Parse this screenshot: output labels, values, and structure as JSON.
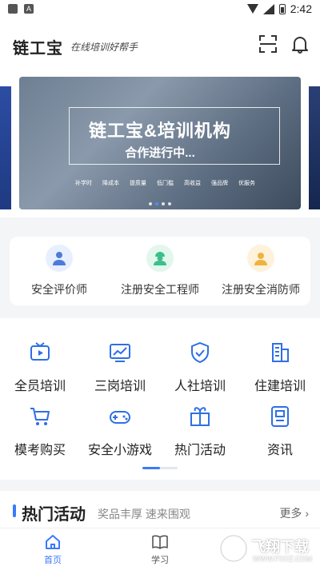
{
  "status_bar": {
    "time": "2:42",
    "left_icon": "A"
  },
  "header": {
    "logo": "链工宝",
    "slogan": "在线培训好帮手"
  },
  "banner": {
    "title": "链工宝&培训机构",
    "subtitle": "合作进行中...",
    "tags": [
      "补学时",
      "降成本",
      "提质量",
      "低门槛",
      "高收益",
      "强品牌",
      "优服务"
    ]
  },
  "certifications": [
    {
      "label": "安全评价师",
      "icon": "evaluator-icon",
      "color": "#4e7bd9"
    },
    {
      "label": "注册安全工程师",
      "icon": "engineer-icon",
      "color": "#3bbf8a"
    },
    {
      "label": "注册安全消防师",
      "icon": "firefighter-icon",
      "color": "#f0b23e"
    }
  ],
  "menu": [
    {
      "label": "全员培训",
      "icon": "video-play-icon"
    },
    {
      "label": "三岗培训",
      "icon": "chart-screen-icon"
    },
    {
      "label": "人社培训",
      "icon": "shield-check-icon"
    },
    {
      "label": "住建培训",
      "icon": "building-icon"
    },
    {
      "label": "模考购买",
      "icon": "cart-icon"
    },
    {
      "label": "安全小游戏",
      "icon": "gamepad-icon"
    },
    {
      "label": "热门活动",
      "icon": "gift-icon"
    },
    {
      "label": "资讯",
      "icon": "news-icon"
    }
  ],
  "hot_section": {
    "title": "热门活动",
    "subtitle": "奖品丰厚 速来围观",
    "more": "更多"
  },
  "tabbar": [
    {
      "label": "首页",
      "active": true
    },
    {
      "label": "学习",
      "active": false
    }
  ],
  "watermark": {
    "text": "飞翔下载",
    "url": "WWW.FXXZ.COM"
  },
  "colors": {
    "accent": "#3a7afe"
  }
}
